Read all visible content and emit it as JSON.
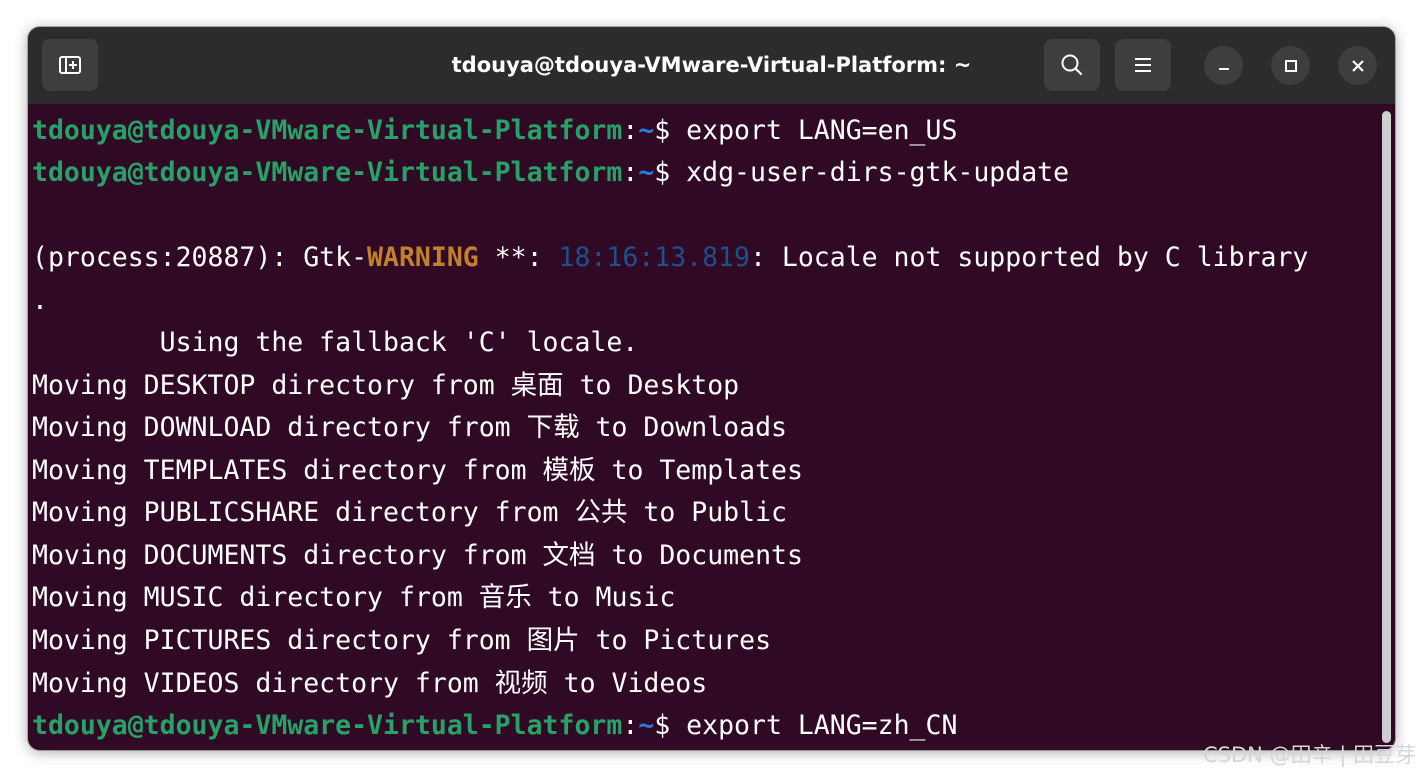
{
  "window": {
    "title": "tdouya@tdouya-VMware-Virtual-Platform: ~",
    "buttons": {
      "new_tab": "new-tab-icon",
      "search": "search-icon",
      "menu": "hamburger-menu-icon",
      "minimize": "minimize-icon",
      "maximize": "maximize-icon",
      "close": "close-icon"
    }
  },
  "colors": {
    "terminal_background": "#300a24",
    "titlebar_background": "#2c2c2c",
    "prompt_user": "#26a269",
    "prompt_path": "#2a7bde",
    "warning": "#c47f2c",
    "timestamp": "#1f4f8c"
  },
  "terminal": {
    "lines": [
      {
        "user": "tdouya@tdouya-VMware-Virtual-Platform",
        "colon": ":",
        "path": "~",
        "dollar": "$ ",
        "command": "export LANG=en_US"
      },
      {
        "user": "tdouya@tdouya-VMware-Virtual-Platform",
        "colon": ":",
        "path": "~",
        "dollar": "$ ",
        "command": "xdg-user-dirs-gtk-update"
      },
      {
        "text": ""
      },
      {
        "prefix": "(process:20887): Gtk-",
        "warning": "WARNING",
        "mid": " **: ",
        "timestamp": "18:16:13.819",
        "message": ": Locale not supported by C library"
      },
      {
        "text": "."
      },
      {
        "text": "        Using the fallback 'C' locale."
      },
      {
        "text": "Moving DESKTOP directory from 桌面 to Desktop"
      },
      {
        "text": "Moving DOWNLOAD directory from 下载 to Downloads"
      },
      {
        "text": "Moving TEMPLATES directory from 模板 to Templates"
      },
      {
        "text": "Moving PUBLICSHARE directory from 公共 to Public"
      },
      {
        "text": "Moving DOCUMENTS directory from 文档 to Documents"
      },
      {
        "text": "Moving MUSIC directory from 音乐 to Music"
      },
      {
        "text": "Moving PICTURES directory from 图片 to Pictures"
      },
      {
        "text": "Moving VIDEOS directory from 视频 to Videos"
      },
      {
        "user": "tdouya@tdouya-VMware-Virtual-Platform",
        "colon": ":",
        "path": "~",
        "dollar": "$ ",
        "command": "export LANG=zh_CN"
      }
    ]
  },
  "watermark": "CSDN @田辛 | 田豆芽"
}
